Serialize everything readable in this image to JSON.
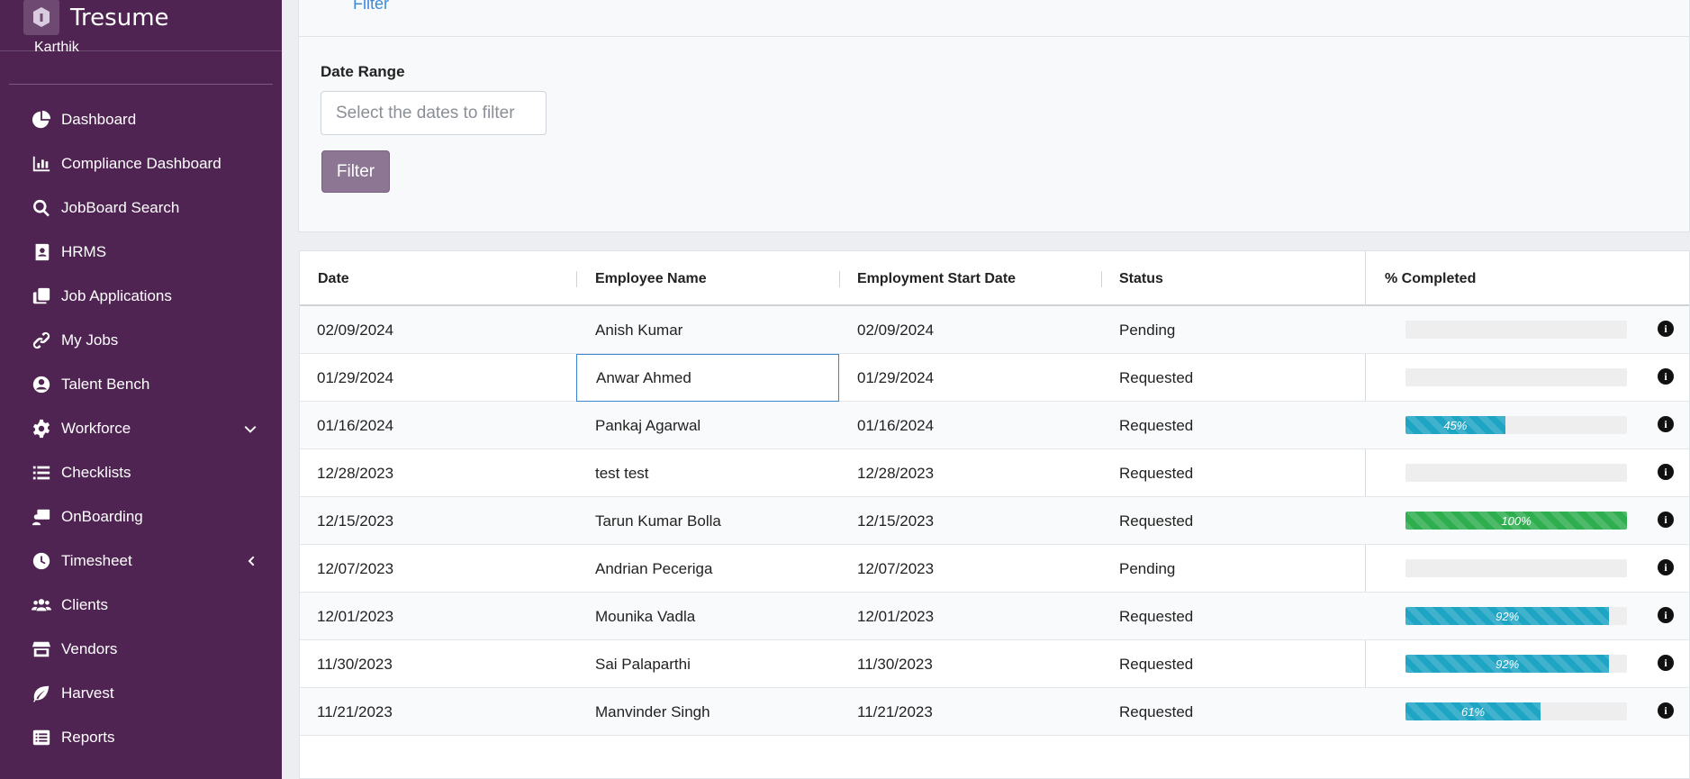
{
  "app": {
    "title": "Tresume",
    "user_name": "Karthik"
  },
  "sidebar": {
    "items": [
      {
        "label": "Dashboard",
        "icon": "pie-chart-icon"
      },
      {
        "label": "Compliance Dashboard",
        "icon": "bar-chart-icon"
      },
      {
        "label": "JobBoard Search",
        "icon": "search-icon"
      },
      {
        "label": "HRMS",
        "icon": "address-book-icon"
      },
      {
        "label": "Job Applications",
        "icon": "copy-icon"
      },
      {
        "label": "My Jobs",
        "icon": "link-icon"
      },
      {
        "label": "Talent Bench",
        "icon": "user-circle-icon"
      },
      {
        "label": "Workforce",
        "icon": "gear-icon",
        "chevron": "down"
      },
      {
        "label": "Checklists",
        "icon": "list-icon"
      },
      {
        "label": "OnBoarding",
        "icon": "onboarding-icon"
      },
      {
        "label": "Timesheet",
        "icon": "clock-icon",
        "chevron": "left"
      },
      {
        "label": "Clients",
        "icon": "users-icon"
      },
      {
        "label": "Vendors",
        "icon": "store-icon"
      },
      {
        "label": "Harvest",
        "icon": "leaf-icon"
      },
      {
        "label": "Reports",
        "icon": "report-icon"
      }
    ]
  },
  "filter": {
    "link_label": "Filter",
    "date_range_label": "Date Range",
    "date_placeholder": "Select the dates to filter",
    "button_label": "Filter"
  },
  "table": {
    "headers": {
      "date": "Date",
      "employee_name": "Employee Name",
      "start_date": "Employment Start Date",
      "status": "Status",
      "completed": "% Completed"
    },
    "rows": [
      {
        "date": "02/09/2024",
        "name": "Anish Kumar",
        "start": "02/09/2024",
        "status": "Pending",
        "progress": 0,
        "label": ""
      },
      {
        "date": "01/29/2024",
        "name": "Anwar Ahmed",
        "start": "01/29/2024",
        "status": "Requested",
        "progress": 0,
        "label": ""
      },
      {
        "date": "01/16/2024",
        "name": "Pankaj Agarwal",
        "start": "01/16/2024",
        "status": "Requested",
        "progress": 45,
        "label": "45%"
      },
      {
        "date": "12/28/2023",
        "name": "test test",
        "start": "12/28/2023",
        "status": "Requested",
        "progress": 0,
        "label": ""
      },
      {
        "date": "12/15/2023",
        "name": "Tarun Kumar Bolla",
        "start": "12/15/2023",
        "status": "Requested",
        "progress": 100,
        "label": "100%"
      },
      {
        "date": "12/07/2023",
        "name": "Andrian Peceriga",
        "start": "12/07/2023",
        "status": "Pending",
        "progress": 0,
        "label": ""
      },
      {
        "date": "12/01/2023",
        "name": "Mounika Vadla",
        "start": "12/01/2023",
        "status": "Requested",
        "progress": 92,
        "label": "92%"
      },
      {
        "date": "11/30/2023",
        "name": "Sai Palaparthi",
        "start": "11/30/2023",
        "status": "Requested",
        "progress": 92,
        "label": "92%"
      },
      {
        "date": "11/21/2023",
        "name": "Manvinder Singh",
        "start": "11/21/2023",
        "status": "Requested",
        "progress": 61,
        "label": "61%"
      }
    ],
    "selected_row": 1
  },
  "colors": {
    "sidebar_bg": "#4f2452",
    "progress_info": "#1ea5c4",
    "progress_success": "#2fae4f",
    "filter_button": "#8c7693",
    "link": "#3d8bd6"
  }
}
